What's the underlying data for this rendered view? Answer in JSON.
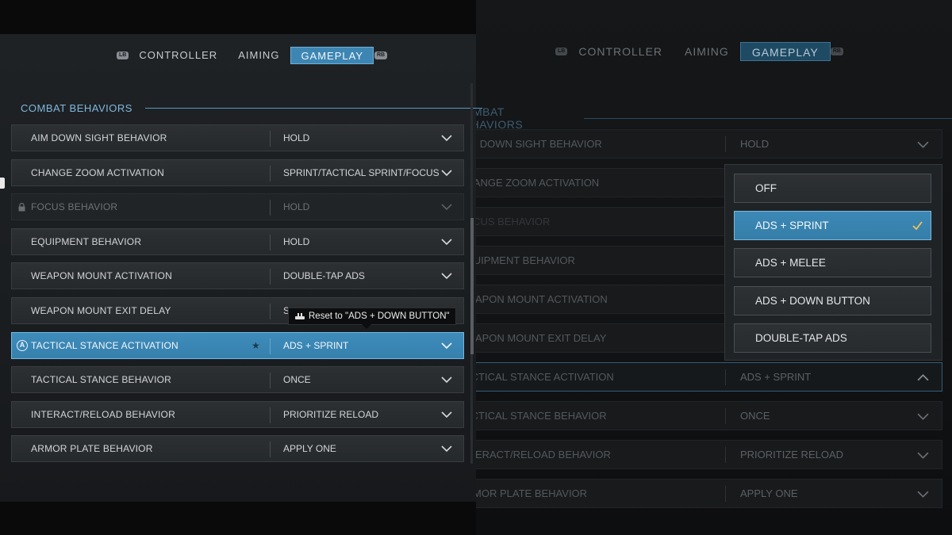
{
  "left": {
    "tabs": [
      {
        "label": "CONTROLLER",
        "active": false
      },
      {
        "label": "AIMING",
        "active": false
      },
      {
        "label": "GAMEPLAY",
        "active": true
      }
    ],
    "bumpers": {
      "left": "LB",
      "right": "RB"
    },
    "section": "COMBAT BEHAVIORS",
    "rows": [
      {
        "name": "AIM DOWN SIGHT BEHAVIOR",
        "value": "HOLD"
      },
      {
        "name": "CHANGE ZOOM ACTIVATION",
        "value": "SPRINT/TACTICAL SPRINT/FOCUS"
      },
      {
        "name": "FOCUS BEHAVIOR",
        "value": "HOLD"
      },
      {
        "name": "EQUIPMENT BEHAVIOR",
        "value": "HOLD"
      },
      {
        "name": "WEAPON MOUNT ACTIVATION",
        "value": "DOUBLE-TAP ADS"
      },
      {
        "name": "WEAPON MOUNT EXIT DELAY",
        "value": "S"
      },
      {
        "name": "TACTICAL STANCE ACTIVATION",
        "value": "ADS + SPRINT"
      },
      {
        "name": "TACTICAL STANCE BEHAVIOR",
        "value": "ONCE"
      },
      {
        "name": "INTERACT/RELOAD BEHAVIOR",
        "value": "PRIORITIZE RELOAD"
      },
      {
        "name": "ARMOR PLATE BEHAVIOR",
        "value": "APPLY ONE"
      }
    ],
    "a_button": "A",
    "star": "★",
    "tooltip": "Reset to \"ADS + DOWN BUTTON\""
  },
  "right": {
    "tabs": [
      {
        "label": "CONTROLLER",
        "active": false
      },
      {
        "label": "AIMING",
        "active": false
      },
      {
        "label": "GAMEPLAY",
        "active": true
      }
    ],
    "bumpers": {
      "left": "LB",
      "right": "RB"
    },
    "section": "COMBAT BEHAVIORS",
    "rows": [
      {
        "name": "AIM DOWN SIGHT BEHAVIOR",
        "value": "HOLD"
      },
      {
        "name": "CHANGE ZOOM ACTIVATION",
        "value": ""
      },
      {
        "name": "FOCUS BEHAVIOR",
        "value": ""
      },
      {
        "name": "EQUIPMENT BEHAVIOR",
        "value": ""
      },
      {
        "name": "WEAPON MOUNT ACTIVATION",
        "value": ""
      },
      {
        "name": "WEAPON MOUNT EXIT DELAY",
        "value": ""
      },
      {
        "name": "TACTICAL STANCE ACTIVATION",
        "value": "ADS + SPRINT"
      },
      {
        "name": "TACTICAL STANCE BEHAVIOR",
        "value": "ONCE"
      },
      {
        "name": "INTERACT/RELOAD BEHAVIOR",
        "value": "PRIORITIZE RELOAD"
      },
      {
        "name": "ARMOR PLATE BEHAVIOR",
        "value": "APPLY ONE"
      }
    ],
    "dropdown": {
      "options": [
        "OFF",
        "ADS + SPRINT",
        "ADS + MELEE",
        "ADS + DOWN BUTTON",
        "DOUBLE-TAP ADS"
      ],
      "selected": "ADS + SPRINT"
    }
  },
  "colors": {
    "accent": "#3d86b4",
    "accent_border": "#76b7df",
    "section_label": "#7fb8de",
    "check": "#f0c35a"
  }
}
